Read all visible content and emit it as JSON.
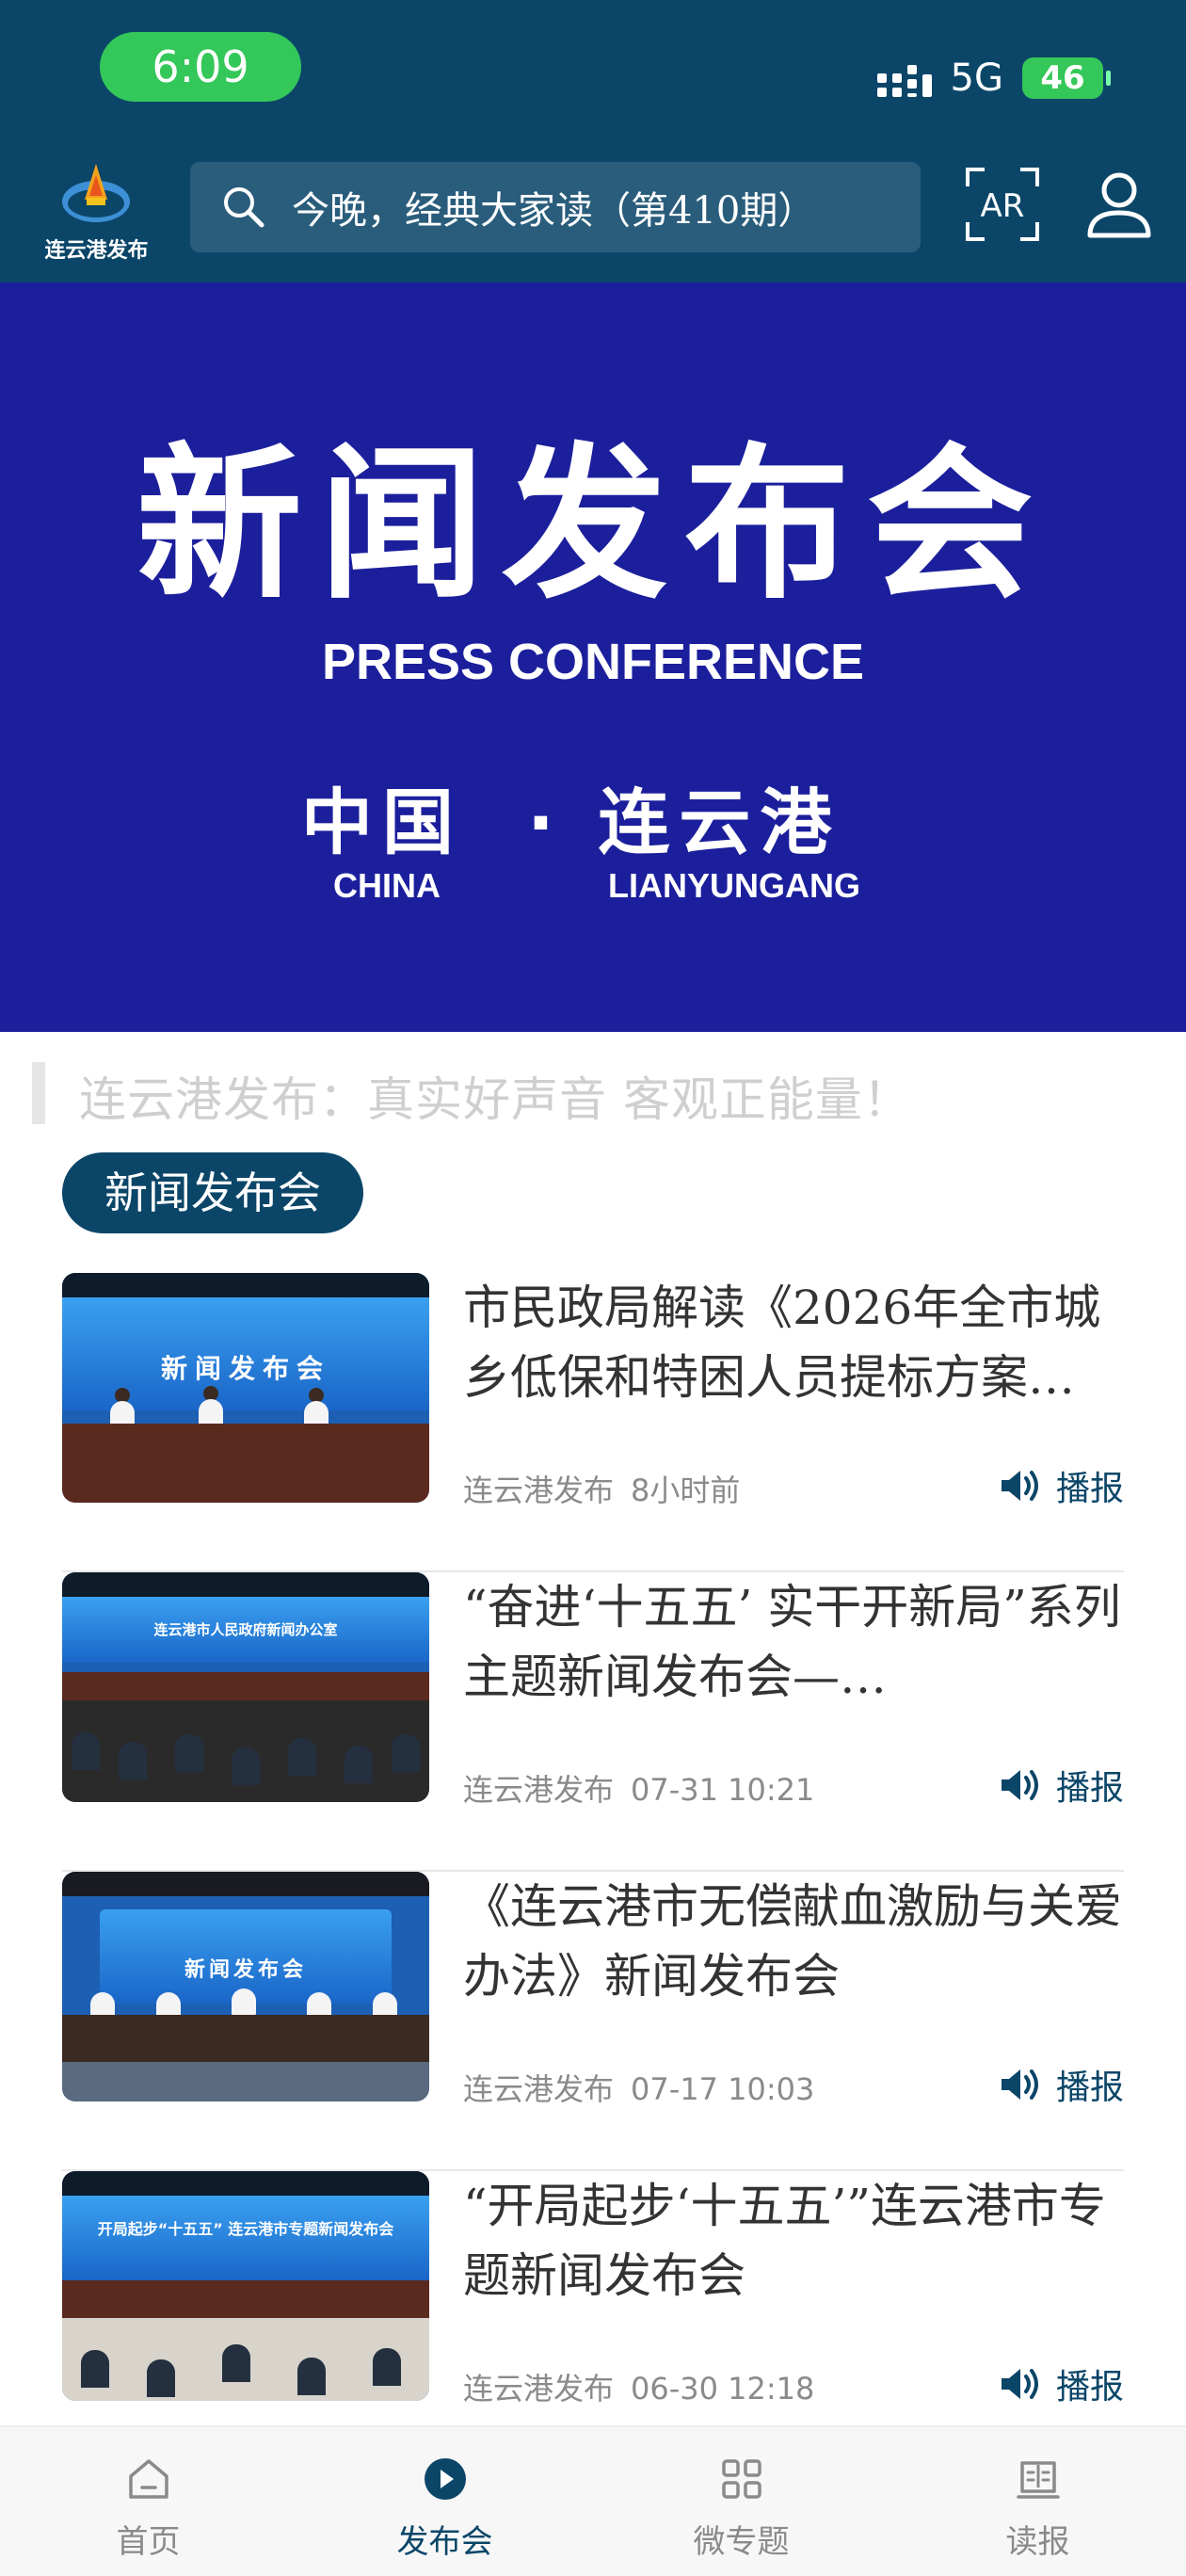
{
  "status_bar": {
    "time": "6:09",
    "network": "5G",
    "battery": "46"
  },
  "header": {
    "logo_text": "连云港发布",
    "search_text": "今晚，经典大家读（第410期）",
    "ar_label": "AR"
  },
  "banner": {
    "title_cn": "新闻发布会",
    "title_en": "PRESS CONFERENCE",
    "place_cn_1": "中国",
    "place_cn_2": "· 连云港",
    "place_en_1": "CHINA",
    "place_en_2": "LIANYUNGANG"
  },
  "slogan": "连云港发布：真实好声音 客观正能量！",
  "section_title": "新闻发布会",
  "broadcast_label": "播报",
  "news": [
    {
      "title": "市民政局解读《2026年全市城乡低保和特困人员提标方案…",
      "source": "连云港发布",
      "time": "8小时前",
      "screen_text": "新闻发布会"
    },
    {
      "title": "“奋进‘十五五’ 实干开新局”系列主题新闻发布会—…",
      "source": "连云港发布",
      "time": "07-31 10:21",
      "screen_text": "连云港市人民政府新闻办公室"
    },
    {
      "title": "《连云港市无偿献血激励与关爱办法》新闻发布会",
      "source": "连云港发布",
      "time": "07-17 10:03",
      "screen_text": "新闻发布会"
    },
    {
      "title": "“开局起步‘十五五’”连云港市专题新闻发布会",
      "source": "连云港发布",
      "time": "06-30 12:18",
      "screen_text": "开局起步“十五五” 连云港市专题新闻发布会"
    }
  ],
  "tabs": [
    {
      "label": "首页",
      "icon": "home-icon",
      "active": false
    },
    {
      "label": "发布会",
      "icon": "play-icon",
      "active": true
    },
    {
      "label": "微专题",
      "icon": "grid-icon",
      "active": false
    },
    {
      "label": "读报",
      "icon": "newspaper-icon",
      "active": false
    }
  ],
  "colors": {
    "header_bg": "#0b4668",
    "banner_bg": "#1c1f9c",
    "accent": "#0b4668",
    "status_green": "#34c759"
  }
}
